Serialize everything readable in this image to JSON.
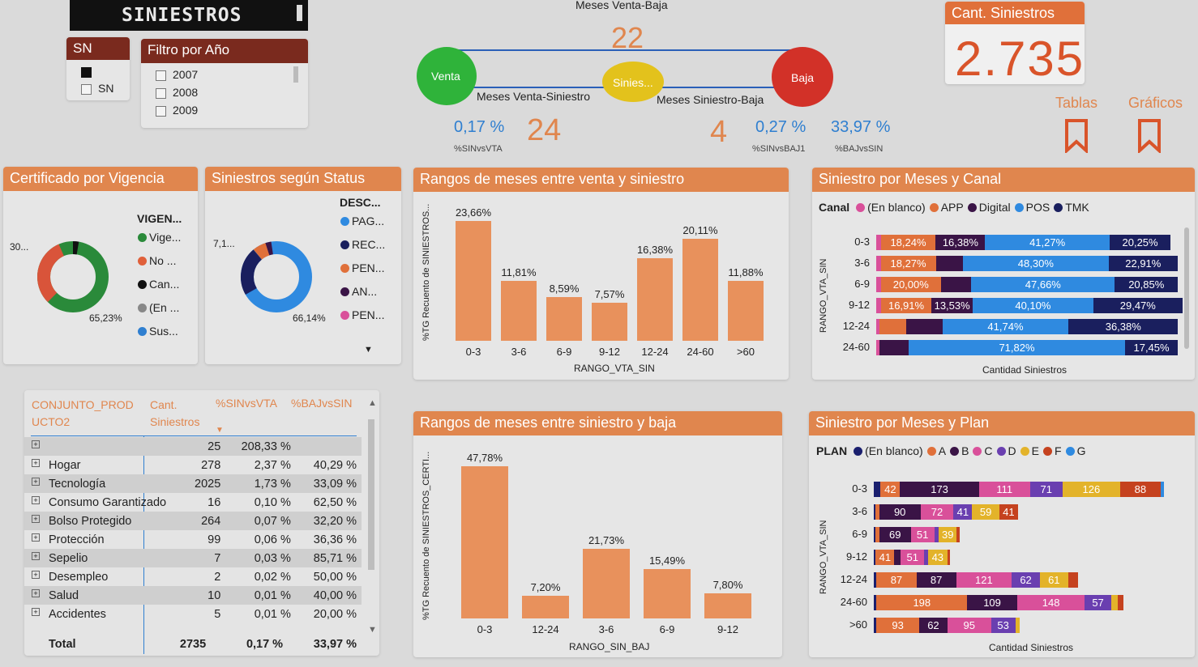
{
  "header": {
    "title": "SINIESTROS"
  },
  "filters": {
    "sn": {
      "title": "SN",
      "items": [
        "",
        "SN"
      ]
    },
    "year": {
      "title": "Filtro por Año",
      "items": [
        "2007",
        "2008",
        "2009"
      ]
    }
  },
  "timeline": {
    "top_label": "Meses Venta-Baja",
    "top_value": "22",
    "venta": "Venta",
    "siniestro": "Sinies...",
    "baja": "Baja",
    "left_label": "Meses Venta-Siniestro",
    "right_label": "Meses Siniestro-Baja",
    "left_value": "24",
    "right_value": "4",
    "kpis": [
      {
        "value": "0,17 %",
        "label": "%SINvsVTA"
      },
      {
        "value": "0,27 %",
        "label": "%SINvsBAJ1"
      },
      {
        "value": "33,97 %",
        "label": "%BAJvsSIN"
      }
    ],
    "colors": {
      "venta": "#2fb33a",
      "siniestro": "#e3c21c",
      "baja": "#d23128",
      "line": "#2a5fb8"
    }
  },
  "cant_card": {
    "title": "Cant. Siniestros",
    "value": "2.735"
  },
  "bookmarks": [
    {
      "label": "Tablas",
      "icon": "bookmark-icon"
    },
    {
      "label": "Gráficos",
      "icon": "bookmark-icon"
    }
  ],
  "donut1": {
    "title": "Certificado por Vigencia",
    "legend_title": "VIGEN...",
    "legend": [
      {
        "label": "Vige...",
        "color": "#2a8a3a"
      },
      {
        "label": "No ...",
        "color": "#e0603a"
      },
      {
        "label": "Can...",
        "color": "#111111"
      },
      {
        "label": "(En ...",
        "color": "#888888"
      },
      {
        "label": "Sus...",
        "color": "#2f7fd0"
      }
    ],
    "label_left": "30...",
    "label_bottom": "65,23%"
  },
  "donut2": {
    "title": "Siniestros según Status",
    "legend_title": "DESC...",
    "legend": [
      {
        "label": "PAG...",
        "color": "#2f8ae0"
      },
      {
        "label": "REC...",
        "color": "#1a1f5e"
      },
      {
        "label": "PEN...",
        "color": "#e0703a"
      },
      {
        "label": "AN...",
        "color": "#3a1446"
      },
      {
        "label": "PEN...",
        "color": "#d9509a"
      }
    ],
    "label_left": "7,1...",
    "label_bottom": "66,14%"
  },
  "table": {
    "headers": [
      "CONJUNTO_PROD UCTO2",
      "Cant. Siniestros",
      "%SINvsVTA",
      "%BAJvsSIN"
    ],
    "rows": [
      [
        "",
        "25",
        "208,33 %",
        ""
      ],
      [
        "Hogar",
        "278",
        "2,37 %",
        "40,29 %"
      ],
      [
        "Tecnología",
        "2025",
        "1,73 %",
        "33,09 %"
      ],
      [
        "Consumo Garantizado",
        "16",
        "0,10 %",
        "62,50 %"
      ],
      [
        "Bolso Protegido",
        "264",
        "0,07 %",
        "32,20 %"
      ],
      [
        "Protección",
        "99",
        "0,06 %",
        "36,36 %"
      ],
      [
        "Sepelio",
        "7",
        "0,03 %",
        "85,71 %"
      ],
      [
        "Desempleo",
        "2",
        "0,02 %",
        "50,00 %"
      ],
      [
        "Salud",
        "10",
        "0,01 %",
        "40,00 %"
      ],
      [
        "Accidentes",
        "5",
        "0,01 %",
        "20,00 %"
      ]
    ],
    "total": [
      "Total",
      "2735",
      "0,17 %",
      "33,97 %"
    ]
  },
  "chart_data": [
    {
      "type": "bar",
      "title": "Rangos de meses entre venta y siniestro",
      "categories": [
        "0-3",
        "3-6",
        "6-9",
        "9-12",
        "12-24",
        "24-60",
        ">60"
      ],
      "values": [
        23.66,
        11.81,
        8.59,
        7.57,
        16.38,
        20.11,
        11.88
      ],
      "labels": [
        "23,66%",
        "11,81%",
        "8,59%",
        "7,57%",
        "16,38%",
        "20,11%",
        "11,88%"
      ],
      "xlabel": "RANGO_VTA_SIN",
      "ylabel": "%TG Recuento de SINIESTROS...",
      "color": "#e8915c"
    },
    {
      "type": "bar",
      "title": "Rangos de meses entre siniestro y baja",
      "categories": [
        "0-3",
        "12-24",
        "3-6",
        "6-9",
        "9-12"
      ],
      "values": [
        47.78,
        7.2,
        21.73,
        15.49,
        7.8
      ],
      "labels": [
        "47,78%",
        "7,20%",
        "21,73%",
        "15,49%",
        "7,80%"
      ],
      "xlabel": "RANGO_SIN_BAJ",
      "ylabel": "%TG Recuento de SINIESTROS_CERTI...",
      "color": "#e8915c"
    },
    {
      "type": "bar",
      "title": "Siniestro por Meses y Canal",
      "legend_title": "Canal",
      "series": [
        {
          "name": "(En blanco)",
          "color": "#d9509a"
        },
        {
          "name": "APP",
          "color": "#e0703a"
        },
        {
          "name": "Digital",
          "color": "#3a1446"
        },
        {
          "name": "POS",
          "color": "#2f8ae0"
        },
        {
          "name": "TMK",
          "color": "#1a1f5e"
        }
      ],
      "categories": [
        "0-3",
        "3-6",
        "6-9",
        "9-12",
        "12-24",
        "24-60"
      ],
      "rows": [
        [
          {
            "s": 0,
            "v": 1.5,
            "l": ""
          },
          {
            "s": 1,
            "v": 18.24,
            "l": "18,24%"
          },
          {
            "s": 2,
            "v": 16.38,
            "l": "16,38%"
          },
          {
            "s": 3,
            "v": 41.27,
            "l": "41,27%"
          },
          {
            "s": 4,
            "v": 20.25,
            "l": "20,25%"
          }
        ],
        [
          {
            "s": 0,
            "v": 1.5,
            "l": ""
          },
          {
            "s": 1,
            "v": 18.27,
            "l": "18,27%"
          },
          {
            "s": 2,
            "v": 9.0,
            "l": ""
          },
          {
            "s": 3,
            "v": 48.3,
            "l": "48,30%"
          },
          {
            "s": 4,
            "v": 22.91,
            "l": "22,91%"
          }
        ],
        [
          {
            "s": 0,
            "v": 1.5,
            "l": ""
          },
          {
            "s": 1,
            "v": 20.0,
            "l": "20,00%"
          },
          {
            "s": 2,
            "v": 10.0,
            "l": ""
          },
          {
            "s": 3,
            "v": 47.66,
            "l": "47,66%"
          },
          {
            "s": 4,
            "v": 20.85,
            "l": "20,85%"
          }
        ],
        [
          {
            "s": 0,
            "v": 1.5,
            "l": ""
          },
          {
            "s": 1,
            "v": 16.91,
            "l": "16,91%"
          },
          {
            "s": 2,
            "v": 13.53,
            "l": "13,53%"
          },
          {
            "s": 3,
            "v": 40.1,
            "l": "40,10%"
          },
          {
            "s": 4,
            "v": 29.47,
            "l": "29,47%"
          }
        ],
        [
          {
            "s": 0,
            "v": 1.0,
            "l": ""
          },
          {
            "s": 1,
            "v": 9.0,
            "l": ""
          },
          {
            "s": 2,
            "v": 12.0,
            "l": ""
          },
          {
            "s": 3,
            "v": 41.74,
            "l": "41,74%"
          },
          {
            "s": 4,
            "v": 36.38,
            "l": "36,38%"
          }
        ],
        [
          {
            "s": 0,
            "v": 1.0,
            "l": ""
          },
          {
            "s": 2,
            "v": 9.73,
            "l": ""
          },
          {
            "s": 3,
            "v": 71.82,
            "l": "71,82%"
          },
          {
            "s": 4,
            "v": 17.45,
            "l": "17,45%"
          }
        ]
      ],
      "xlabel": "Cantidad Siniestros",
      "ylabel": "RANGO_VTA_SIN"
    },
    {
      "type": "bar",
      "title": "Siniestro por Meses y Plan",
      "legend_title": "PLAN",
      "series": [
        {
          "name": "(En blanco)",
          "color": "#1a1f6e"
        },
        {
          "name": "A",
          "color": "#e0703a"
        },
        {
          "name": "B",
          "color": "#3a1446"
        },
        {
          "name": "C",
          "color": "#d9509a"
        },
        {
          "name": "D",
          "color": "#6a3fb0"
        },
        {
          "name": "E",
          "color": "#e3b32a"
        },
        {
          "name": "F",
          "color": "#c5421f"
        },
        {
          "name": "G",
          "color": "#2f8ae0"
        }
      ],
      "categories": [
        "0-3",
        "3-6",
        "6-9",
        "9-12",
        "12-24",
        "24-60",
        ">60"
      ],
      "rows": [
        [
          {
            "s": 0,
            "v": 15,
            "l": ""
          },
          {
            "s": 1,
            "v": 42,
            "l": "42"
          },
          {
            "s": 2,
            "v": 173,
            "l": "173"
          },
          {
            "s": 3,
            "v": 111,
            "l": "111"
          },
          {
            "s": 4,
            "v": 71,
            "l": "71"
          },
          {
            "s": 5,
            "v": 126,
            "l": "126"
          },
          {
            "s": 6,
            "v": 88,
            "l": "88"
          },
          {
            "s": 7,
            "v": 8,
            "l": ""
          }
        ],
        [
          {
            "s": 0,
            "v": 4,
            "l": ""
          },
          {
            "s": 1,
            "v": 8,
            "l": ""
          },
          {
            "s": 2,
            "v": 90,
            "l": "90"
          },
          {
            "s": 3,
            "v": 72,
            "l": "72"
          },
          {
            "s": 4,
            "v": 41,
            "l": "41"
          },
          {
            "s": 5,
            "v": 59,
            "l": "59"
          },
          {
            "s": 6,
            "v": 41,
            "l": "41"
          }
        ],
        [
          {
            "s": 0,
            "v": 4,
            "l": ""
          },
          {
            "s": 1,
            "v": 8,
            "l": ""
          },
          {
            "s": 2,
            "v": 69,
            "l": "69"
          },
          {
            "s": 3,
            "v": 51,
            "l": "51"
          },
          {
            "s": 4,
            "v": 10,
            "l": ""
          },
          {
            "s": 5,
            "v": 39,
            "l": "39"
          },
          {
            "s": 6,
            "v": 6,
            "l": ""
          }
        ],
        [
          {
            "s": 0,
            "v": 4,
            "l": ""
          },
          {
            "s": 1,
            "v": 41,
            "l": "41"
          },
          {
            "s": 2,
            "v": 14,
            "l": ""
          },
          {
            "s": 3,
            "v": 51,
            "l": "51"
          },
          {
            "s": 4,
            "v": 8,
            "l": ""
          },
          {
            "s": 5,
            "v": 43,
            "l": "43"
          },
          {
            "s": 6,
            "v": 6,
            "l": ""
          }
        ],
        [
          {
            "s": 0,
            "v": 6,
            "l": ""
          },
          {
            "s": 1,
            "v": 87,
            "l": "87"
          },
          {
            "s": 2,
            "v": 87,
            "l": "87"
          },
          {
            "s": 3,
            "v": 121,
            "l": "121"
          },
          {
            "s": 4,
            "v": 62,
            "l": "62"
          },
          {
            "s": 5,
            "v": 61,
            "l": "61"
          },
          {
            "s": 6,
            "v": 22,
            "l": ""
          }
        ],
        [
          {
            "s": 0,
            "v": 6,
            "l": ""
          },
          {
            "s": 1,
            "v": 198,
            "l": "198"
          },
          {
            "s": 2,
            "v": 109,
            "l": "109"
          },
          {
            "s": 3,
            "v": 148,
            "l": "148"
          },
          {
            "s": 4,
            "v": 57,
            "l": "57"
          },
          {
            "s": 5,
            "v": 15,
            "l": ""
          },
          {
            "s": 6,
            "v": 12,
            "l": ""
          }
        ],
        [
          {
            "s": 0,
            "v": 6,
            "l": ""
          },
          {
            "s": 1,
            "v": 93,
            "l": "93"
          },
          {
            "s": 2,
            "v": 62,
            "l": "62"
          },
          {
            "s": 3,
            "v": 95,
            "l": "95"
          },
          {
            "s": 4,
            "v": 53,
            "l": "53"
          },
          {
            "s": 5,
            "v": 10,
            "l": ""
          }
        ]
      ],
      "xlabel": "Cantidad Siniestros",
      "ylabel": "RANGO_VTA_SIN"
    }
  ]
}
